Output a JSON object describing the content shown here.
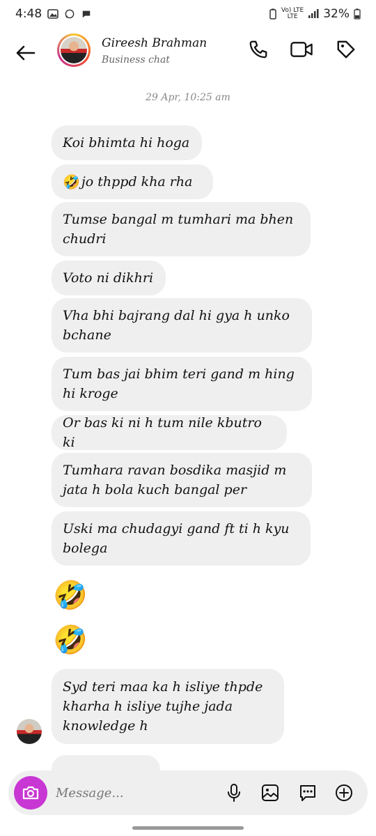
{
  "status": {
    "time": "4:48",
    "network_top": "Vo) LTE",
    "network_bottom": "LTE",
    "battery": "32%"
  },
  "header": {
    "name": "Gireesh Brahman",
    "subtitle": "Business chat"
  },
  "timestamp": "29 Apr, 10:25 am",
  "messages": [
    {
      "text": "Koi bhimta hi hoga"
    },
    {
      "emoji": "🤣",
      "text": "jo thppd kha rha"
    },
    {
      "line1": "Tumse bangal m tumhari ma bhen",
      "line2": "chudri"
    },
    {
      "text": "Voto ni dikhri"
    },
    {
      "line1": "Vha bhi bajrang dal hi gya h unko",
      "line2": "bchane"
    },
    {
      "line1": "Tum bas jai bhim teri gand m hing",
      "line2": "hi kroge"
    },
    {
      "text": "Or bas ki ni h tum nile kbutro ki"
    },
    {
      "line1": "Tumhara ravan bosdika masjid m",
      "line2": "jata h bola kuch bangal per"
    },
    {
      "line1": "Uski ma chudagyi gand ft ti h kyu",
      "line2": "bolega"
    },
    {
      "emoji": "🤣"
    },
    {
      "emoji": "🤣"
    },
    {
      "line1": "Syd teri maa ka h isliye thpde",
      "line2": "kharha h isliye tujhe jada",
      "line3": "knowledge h"
    }
  ],
  "composer": {
    "placeholder": "Message..."
  },
  "colors": {
    "bubble": "#efefef",
    "camera": "#c837d3",
    "text": "#111111"
  },
  "icons": [
    "back-arrow-icon",
    "phone-icon",
    "video-icon",
    "tag-icon",
    "camera-icon",
    "microphone-icon",
    "gallery-icon",
    "sticker-icon",
    "plus-icon"
  ]
}
